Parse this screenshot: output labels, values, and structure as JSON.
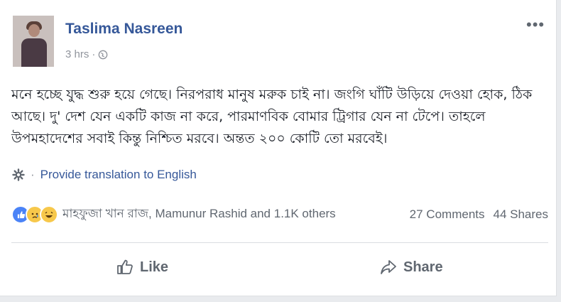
{
  "post": {
    "author": "Taslima Nasreen",
    "time": "3 hrs",
    "time_separator": "·",
    "more_menu": "•••",
    "text": "মনে হচ্ছে যুদ্ধ শুরু হয়ে গেছে। নিরপরাধ মানুষ মরুক চাই না। জংগি ঘাঁটি উড়িয়ে দেওয়া হোক, ঠিক আছে। দু' দেশ যেন একটি কাজ না করে, পারমাণবিক বোমার ট্রিগার যেন না টেপে। তাহলে উপমহাদেশের সবাই কিন্তু নিশ্চিত মরবে। অন্তত ২০০ কোটি তো মরবেই।"
  },
  "translation": {
    "separator": "·",
    "link": "Provide translation to English"
  },
  "reactions": {
    "icons": [
      "like-reaction-icon",
      "sad-reaction-icon",
      "haha-reaction-icon"
    ],
    "reacted_by": "মাহফুজা খান রাজ, Mamunur Rashid and 1.1K others",
    "comments": "27 Comments",
    "shares": "44 Shares"
  },
  "actions": {
    "like": "Like",
    "share": "Share"
  },
  "colors": {
    "link": "#365899",
    "like_reaction": "#4a83f7",
    "emoji_reaction": "#f7c84b",
    "muted": "#90949c"
  }
}
